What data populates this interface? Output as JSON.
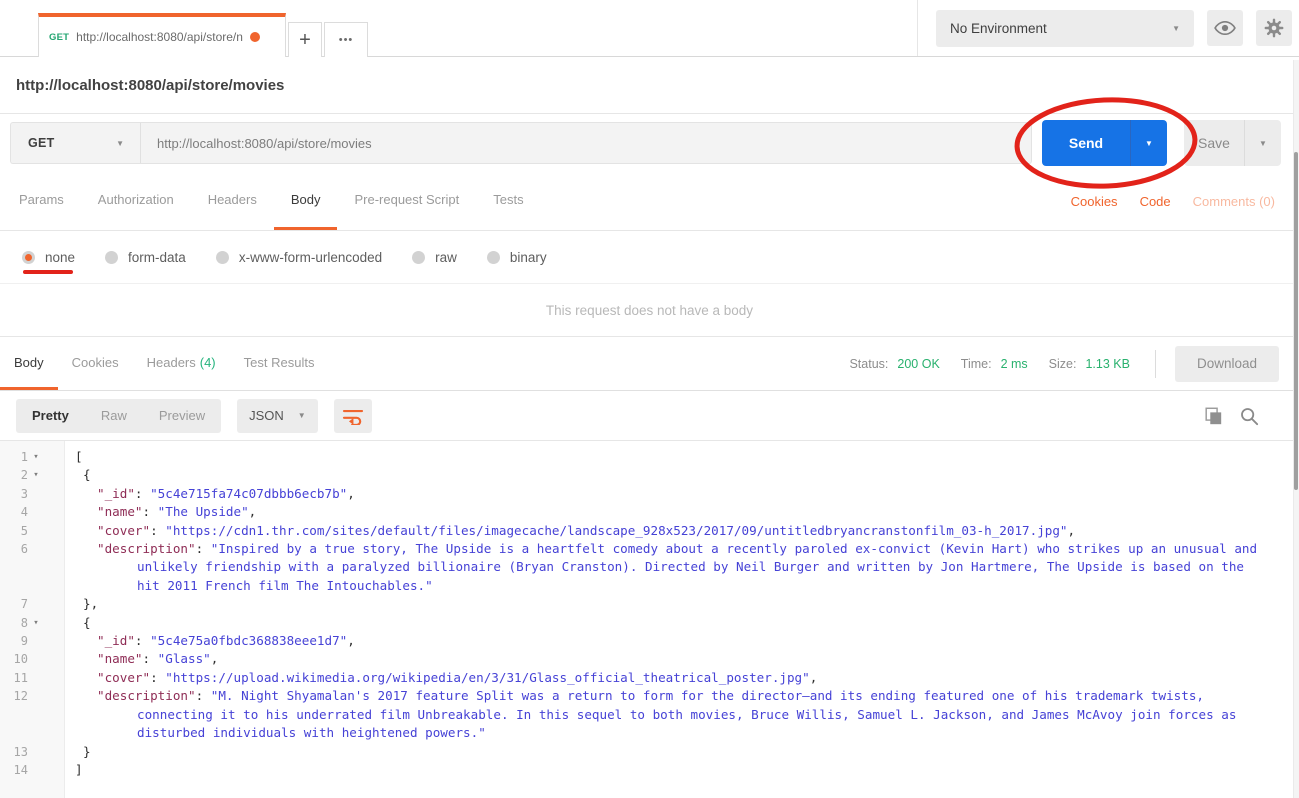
{
  "colors": {
    "accent_orange": "#f0642d",
    "method_green": "#23a571",
    "send_blue": "#1673e6",
    "status_green": "#29b16e",
    "annotation_red": "#e2231a",
    "json_key": "#8f2d56",
    "json_string": "#4642d6"
  },
  "topbar": {
    "tab": {
      "method": "GET",
      "url": "http://localhost:8080/api/store/n"
    },
    "new_tab_label": "+",
    "more_tabs_label": "•••",
    "environment_selector": "No Environment"
  },
  "title": "http://localhost:8080/api/store/movies",
  "request": {
    "method": "GET",
    "url": "http://localhost:8080/api/store/movies",
    "send_label": "Send",
    "save_label": "Save"
  },
  "request_tabs": [
    {
      "label": "Params",
      "active": false
    },
    {
      "label": "Authorization",
      "active": false
    },
    {
      "label": "Headers",
      "active": false
    },
    {
      "label": "Body",
      "active": true
    },
    {
      "label": "Pre-request Script",
      "active": false
    },
    {
      "label": "Tests",
      "active": false
    }
  ],
  "request_links": {
    "cookies": "Cookies",
    "code": "Code",
    "comments": "Comments (0)"
  },
  "body_types": [
    {
      "label": "none",
      "selected": true
    },
    {
      "label": "form-data",
      "selected": false
    },
    {
      "label": "x-www-form-urlencoded",
      "selected": false
    },
    {
      "label": "raw",
      "selected": false
    },
    {
      "label": "binary",
      "selected": false
    }
  ],
  "empty_body_message": "This request does not have a body",
  "response": {
    "tabs": [
      {
        "label": "Body",
        "active": true
      },
      {
        "label": "Cookies",
        "active": false
      },
      {
        "label": "Headers",
        "count": "(4)",
        "active": false
      },
      {
        "label": "Test Results",
        "active": false
      }
    ],
    "meta": [
      {
        "label": "Status:",
        "value": "200 OK"
      },
      {
        "label": "Time:",
        "value": "2 ms"
      },
      {
        "label": "Size:",
        "value": "1.13 KB"
      }
    ],
    "download_label": "Download",
    "view_modes": [
      "Pretty",
      "Raw",
      "Preview"
    ],
    "active_view": "Pretty",
    "language": "JSON"
  },
  "code": {
    "lines": [
      {
        "num": 1,
        "fold": true,
        "indent": 0,
        "tokens": [
          {
            "t": "p",
            "v": "["
          }
        ]
      },
      {
        "num": 2,
        "fold": true,
        "indent": 1,
        "tokens": [
          {
            "t": "p",
            "v": "{"
          }
        ]
      },
      {
        "num": 3,
        "fold": false,
        "indent": 2,
        "tokens": [
          {
            "t": "k",
            "v": "\"_id\""
          },
          {
            "t": "p",
            "v": ": "
          },
          {
            "t": "s",
            "v": "\"5c4e715fa74c07dbbb6ecb7b\""
          },
          {
            "t": "p",
            "v": ","
          }
        ]
      },
      {
        "num": 4,
        "fold": false,
        "indent": 2,
        "tokens": [
          {
            "t": "k",
            "v": "\"name\""
          },
          {
            "t": "p",
            "v": ": "
          },
          {
            "t": "s",
            "v": "\"The Upside\""
          },
          {
            "t": "p",
            "v": ","
          }
        ]
      },
      {
        "num": 5,
        "fold": false,
        "indent": 2,
        "tokens": [
          {
            "t": "k",
            "v": "\"cover\""
          },
          {
            "t": "p",
            "v": ": "
          },
          {
            "t": "s",
            "v": "\"https://cdn1.thr.com/sites/default/files/imagecache/landscape_928x523/2017/09/untitledbryancranstonfilm_03-h_2017.jpg\""
          },
          {
            "t": "p",
            "v": ","
          }
        ]
      },
      {
        "num": 6,
        "fold": false,
        "indent": 2,
        "tokens": [
          {
            "t": "k",
            "v": "\"description\""
          },
          {
            "t": "p",
            "v": ": "
          },
          {
            "t": "s",
            "v": "\"Inspired by a true story, The Upside is a heartfelt comedy about a recently paroled ex-convict (Kevin Hart) who strikes up an unusual and unlikely friendship with a paralyzed billionaire (Bryan Cranston). Directed by Neil Burger and written by Jon Hartmere, The Upside is based on the hit 2011 French film The Intouchables.\""
          }
        ]
      },
      {
        "num": 7,
        "fold": false,
        "indent": 1,
        "tokens": [
          {
            "t": "p",
            "v": "},"
          }
        ]
      },
      {
        "num": 8,
        "fold": true,
        "indent": 1,
        "tokens": [
          {
            "t": "p",
            "v": "{"
          }
        ]
      },
      {
        "num": 9,
        "fold": false,
        "indent": 2,
        "tokens": [
          {
            "t": "k",
            "v": "\"_id\""
          },
          {
            "t": "p",
            "v": ": "
          },
          {
            "t": "s",
            "v": "\"5c4e75a0fbdc368838eee1d7\""
          },
          {
            "t": "p",
            "v": ","
          }
        ]
      },
      {
        "num": 10,
        "fold": false,
        "indent": 2,
        "tokens": [
          {
            "t": "k",
            "v": "\"name\""
          },
          {
            "t": "p",
            "v": ": "
          },
          {
            "t": "s",
            "v": "\"Glass\""
          },
          {
            "t": "p",
            "v": ","
          }
        ]
      },
      {
        "num": 11,
        "fold": false,
        "indent": 2,
        "tokens": [
          {
            "t": "k",
            "v": "\"cover\""
          },
          {
            "t": "p",
            "v": ": "
          },
          {
            "t": "s",
            "v": "\"https://upload.wikimedia.org/wikipedia/en/3/31/Glass_official_theatrical_poster.jpg\""
          },
          {
            "t": "p",
            "v": ","
          }
        ]
      },
      {
        "num": 12,
        "fold": false,
        "indent": 2,
        "tokens": [
          {
            "t": "k",
            "v": "\"description\""
          },
          {
            "t": "p",
            "v": ": "
          },
          {
            "t": "s",
            "v": "\"M. Night Shyamalan's 2017 feature Split was a return to form for the director—and its ending featured one of his trademark twists, connecting it to his underrated film Unbreakable. In this sequel to both movies, Bruce Willis, Samuel L. Jackson, and James McAvoy join forces as disturbed individuals with heightened powers.\""
          }
        ]
      },
      {
        "num": 13,
        "fold": false,
        "indent": 1,
        "tokens": [
          {
            "t": "p",
            "v": "}"
          }
        ]
      },
      {
        "num": 14,
        "fold": false,
        "indent": 0,
        "tokens": [
          {
            "t": "p",
            "v": "]"
          }
        ]
      }
    ]
  }
}
